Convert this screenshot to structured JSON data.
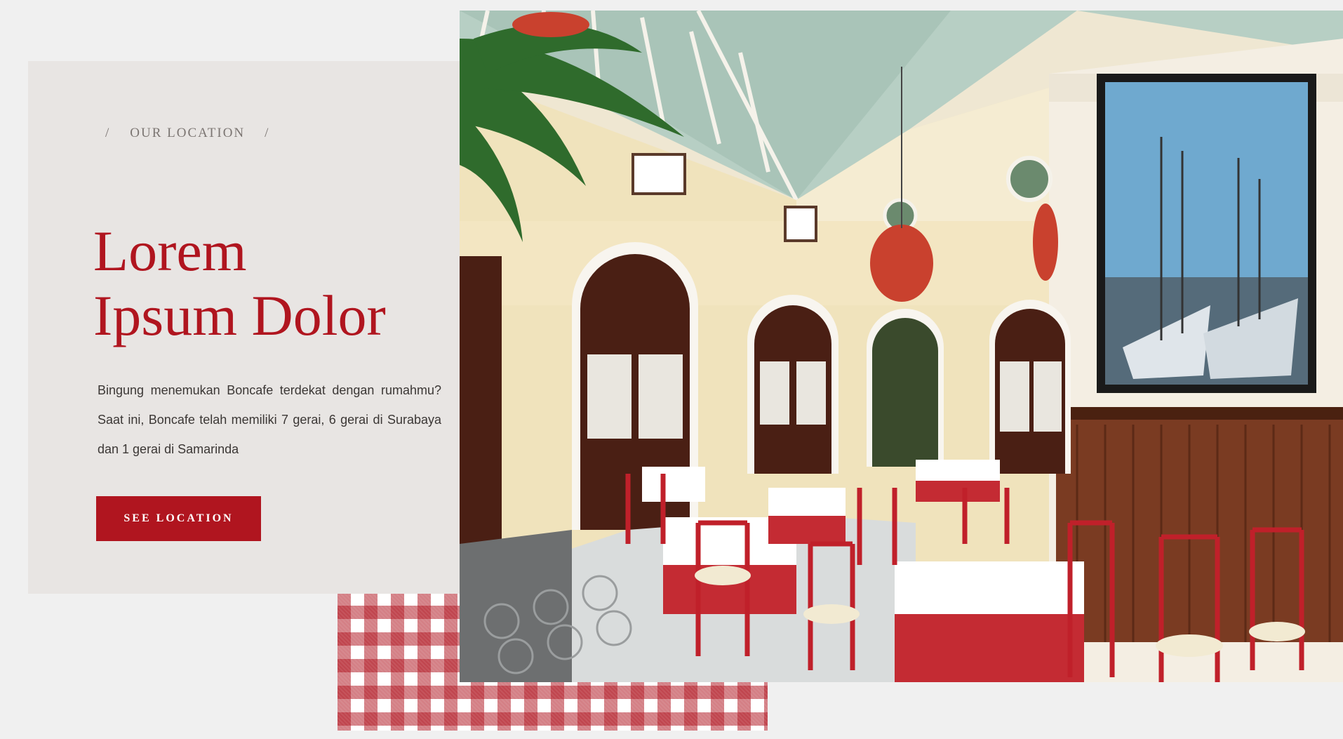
{
  "location_section": {
    "eyebrow_slash_left": "/",
    "eyebrow": "OUR LOCATION",
    "eyebrow_slash_right": "/",
    "title_line1": "Lorem",
    "title_line2": "Ipsum Dolor",
    "description": "Bingung menemukan Boncafe terdekat dengan rumahmu? Saat ini, Boncafe telah memiliki 7 gerai, 6 gerai di Surabaya dan 1 gerai di Samarinda",
    "cta_label": "SEE LOCATION"
  },
  "colors": {
    "brand_red": "#b0151f",
    "card_bg": "#e8e5e3",
    "page_bg": "#f0f0f0"
  },
  "media": {
    "photo": "restaurant-interior-photo",
    "swatch": "red-gingham-tablecloth"
  }
}
